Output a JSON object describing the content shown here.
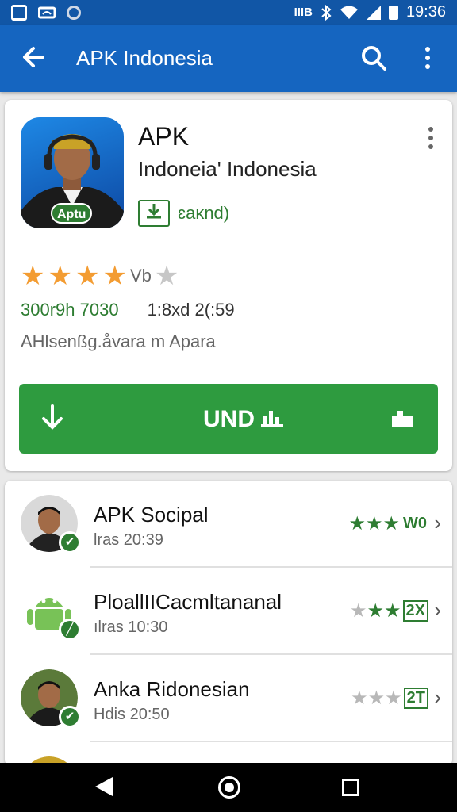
{
  "status_bar": {
    "time": "19:36",
    "icons": [
      "photo-icon",
      "voicemail-icon",
      "circle-icon",
      "vibrate-icon",
      "bluetooth-icon",
      "wifi-icon",
      "signal-icon",
      "battery-icon"
    ],
    "vibrate_text": "IIIB"
  },
  "app_bar": {
    "title": "APK Indonesia",
    "background": "#1565c0",
    "icons": [
      "back-arrow-icon",
      "search-icon",
      "more-vert-icon"
    ]
  },
  "app": {
    "name": "APK",
    "developer": "Indoneia' Indonesia",
    "icon_badge": "Aptu",
    "tag_label": "ɛaκnd)",
    "rating_text": "Vb",
    "stars_filled": 4,
    "stars_total": 5,
    "meta_left": "300r9h 7030",
    "meta_right": "1:8xd 2(:59",
    "description": "AHlsenßg.åvara m Apara",
    "install_label": "UND",
    "install_color": "#2e9b3f",
    "star_color": "#f39c32"
  },
  "list": [
    {
      "title": "APK Socipal",
      "subtitle": "lras 20:39",
      "rating_label": "W0",
      "stars_filled": 3,
      "stars_total": 3,
      "boxed": false
    },
    {
      "title": "PloallIICacmltananal",
      "subtitle": "ılras 10:30",
      "rating_label": "2X",
      "stars_filled": 2,
      "stars_total": 3,
      "boxed": true
    },
    {
      "title": "Anka Ridonesian",
      "subtitle": "Hdis 20:50",
      "rating_label": "2T",
      "stars_filled": 0,
      "stars_total": 3,
      "boxed": true
    }
  ],
  "nav_bar": {
    "icons": [
      "nav-back-icon",
      "nav-home-icon",
      "nav-recents-icon"
    ]
  }
}
